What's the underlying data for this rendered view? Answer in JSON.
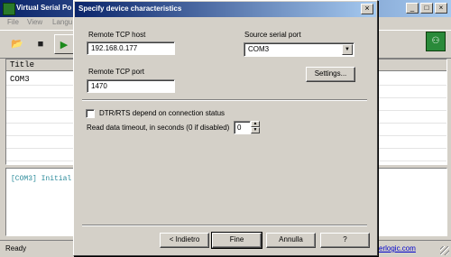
{
  "background_app": {
    "title": "Virtual Serial Po",
    "menu": [
      "File",
      "View",
      "Langu"
    ],
    "list_header": "Title",
    "list_rows": [
      "COM3",
      "",
      "",
      "",
      "",
      "",
      ""
    ],
    "log_text": "[COM3] Initial",
    "status_text": "Ready",
    "status_link": "cerlogic.com",
    "window_buttons": [
      "_",
      "□",
      "×"
    ]
  },
  "dialog": {
    "title": "Specify device characteristics",
    "close_glyph": "×",
    "remote_host": {
      "label": "Remote TCP host",
      "value": "192.168.0.177"
    },
    "remote_port": {
      "label": "Remote TCP port",
      "value": "1470"
    },
    "source_port": {
      "label": "Source serial port",
      "value": "COM3"
    },
    "settings_button": "Settings...",
    "dtr_rts_checkbox": {
      "label": "DTR/RTS depend on connection status",
      "checked": false
    },
    "timeout": {
      "label": "Read data timeout, in seconds (0 if disabled)",
      "value": "0"
    },
    "buttons": {
      "back": "< Indietro",
      "finish": "Fine",
      "cancel": "Annulla",
      "help": "?"
    }
  },
  "icons": {
    "open": "folder-icon",
    "save": "save-icon",
    "start": "play-icon",
    "network": "network-icon",
    "app": "app-icon"
  }
}
